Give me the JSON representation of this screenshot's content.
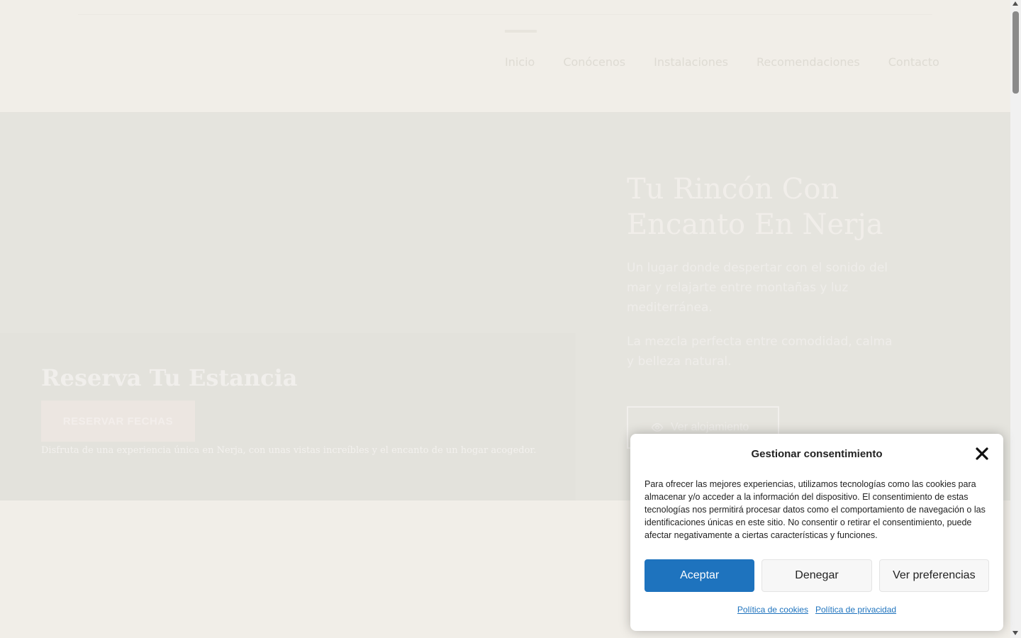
{
  "nav": {
    "items": [
      {
        "label": "Inicio",
        "active": true
      },
      {
        "label": "Conócenos"
      },
      {
        "label": "Instalaciones"
      },
      {
        "label": "Recomendaciones"
      },
      {
        "label": "Contacto"
      }
    ]
  },
  "hero": {
    "title": "Tu Rincón Con Encanto En Nerja",
    "paragraph1": "Un lugar donde despertar con el sonido del mar y relajarte entre montañas y luz mediterránea.",
    "paragraph2": "La mezcla perfecta entre comodidad, calma y belleza natural.",
    "button_label": "Ver alojamiento",
    "button_icon": "eye-icon"
  },
  "reserve": {
    "title": "Reserva Tu Estancia",
    "button_label": "RESERVAR FECHAS",
    "description": "Disfruta de una experiencia única en Nerja, con unas vistas increíbles y el encanto de un hogar acogedor."
  },
  "consent": {
    "title": "Gestionar consentimiento",
    "close_icon": "close-icon",
    "text": "Para ofrecer las mejores experiencias, utilizamos tecnologías como las cookies para almacenar y/o acceder a la información del dispositivo. El consentimiento de estas tecnologías nos permitirá procesar datos como el comportamiento de navegación o las identificaciones únicas en este sitio. No consentir o retirar el consentimiento, puede afectar negativamente a ciertas características y funciones.",
    "accept_label": "Aceptar",
    "deny_label": "Denegar",
    "preferences_label": "Ver preferencias",
    "cookie_policy_label": "Política de cookies",
    "privacy_policy_label": "Política de privacidad"
  },
  "colors": {
    "accent": "#1e73be",
    "page_background": "#f1eee8",
    "hero_background": "#e5e4de"
  }
}
